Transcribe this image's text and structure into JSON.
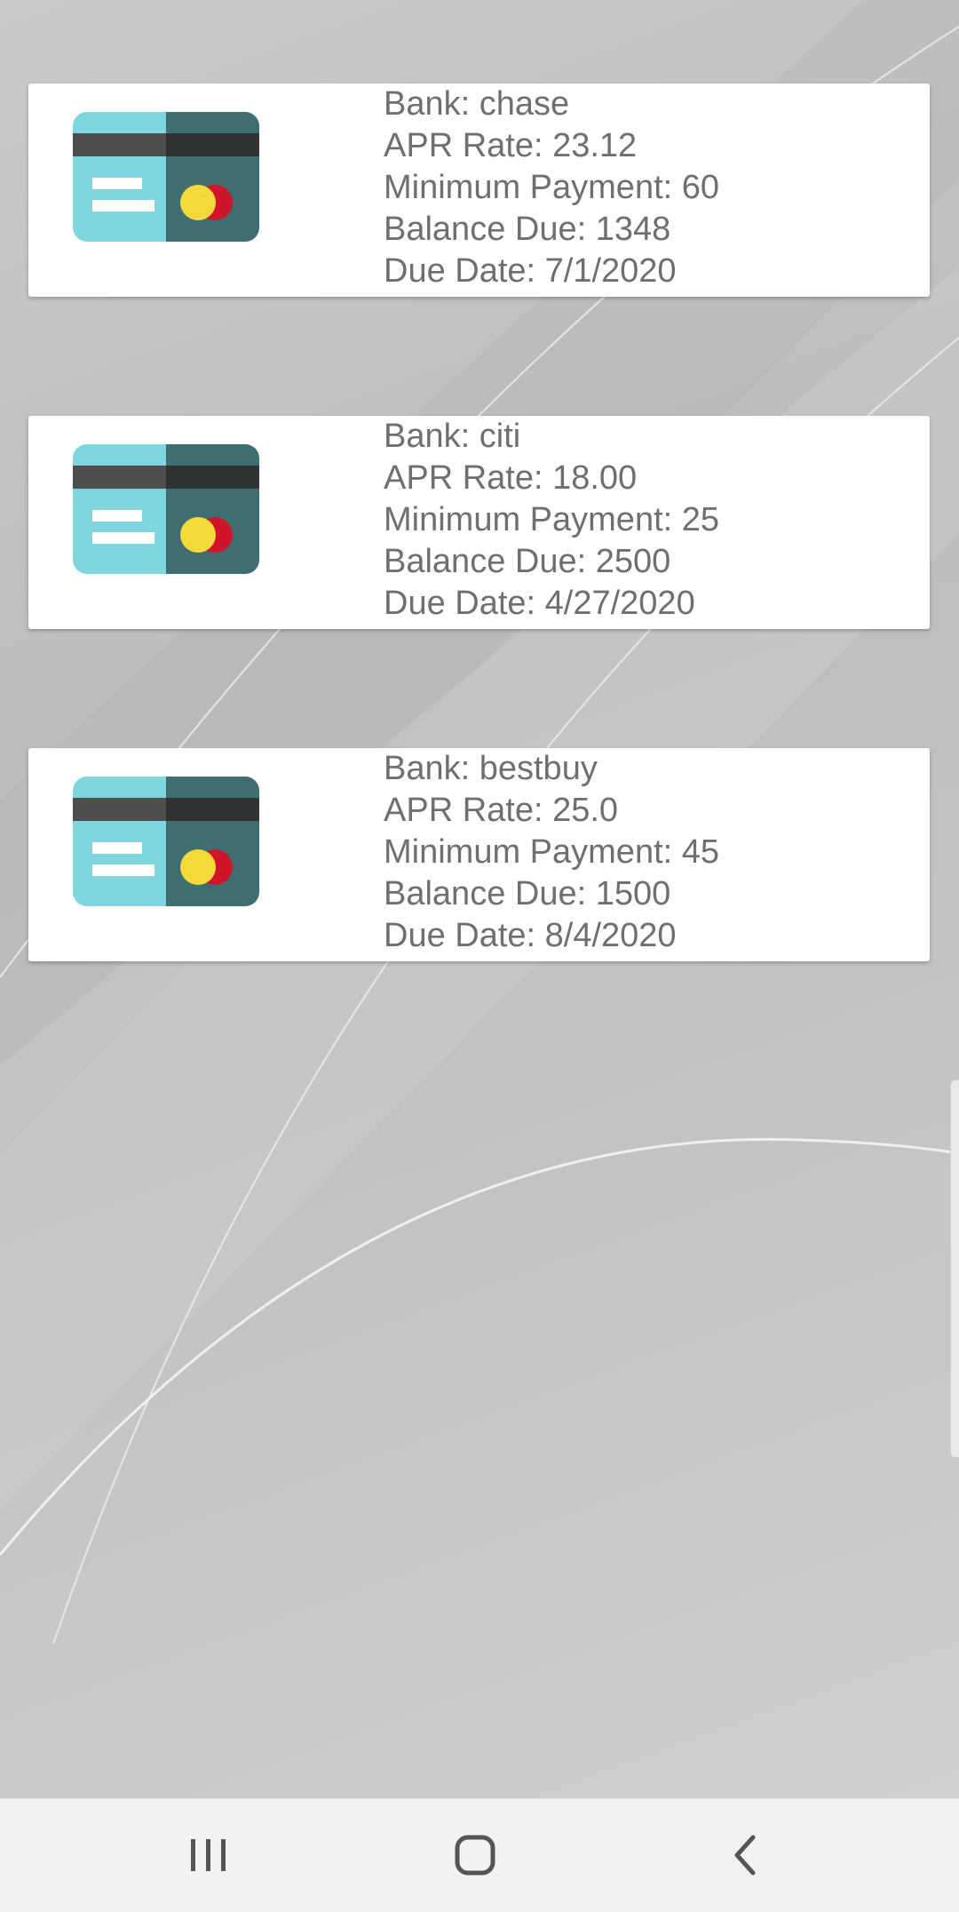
{
  "cards": [
    {
      "icon": "credit-card-icon",
      "lines": [
        "Bank: chase",
        "APR Rate: 23.12",
        "Minimum Payment: 60",
        "Balance Due: 1348",
        "Due Date: 7/1/2020"
      ]
    },
    {
      "icon": "credit-card-icon",
      "lines": [
        "Bank: citi",
        "APR Rate: 18.00",
        "Minimum Payment: 25",
        "Balance Due: 2500",
        "Due Date: 4/27/2020"
      ]
    },
    {
      "icon": "credit-card-icon",
      "lines": [
        "Bank: bestbuy",
        "APR Rate: 25.0",
        "Minimum Payment: 45",
        "Balance Due: 1500",
        "Due Date: 8/4/2020"
      ]
    }
  ],
  "navbar": {
    "recent_icon": "recent-apps-icon",
    "home_icon": "home-icon",
    "back_icon": "back-icon"
  },
  "colors": {
    "card_text": "#6f6f6f",
    "card_light": "#7fd6de",
    "card_dark": "#3f6e70",
    "stripe": "#4e4e4e",
    "chip_yellow": "#f4d93a",
    "chip_red": "#d0142a"
  }
}
